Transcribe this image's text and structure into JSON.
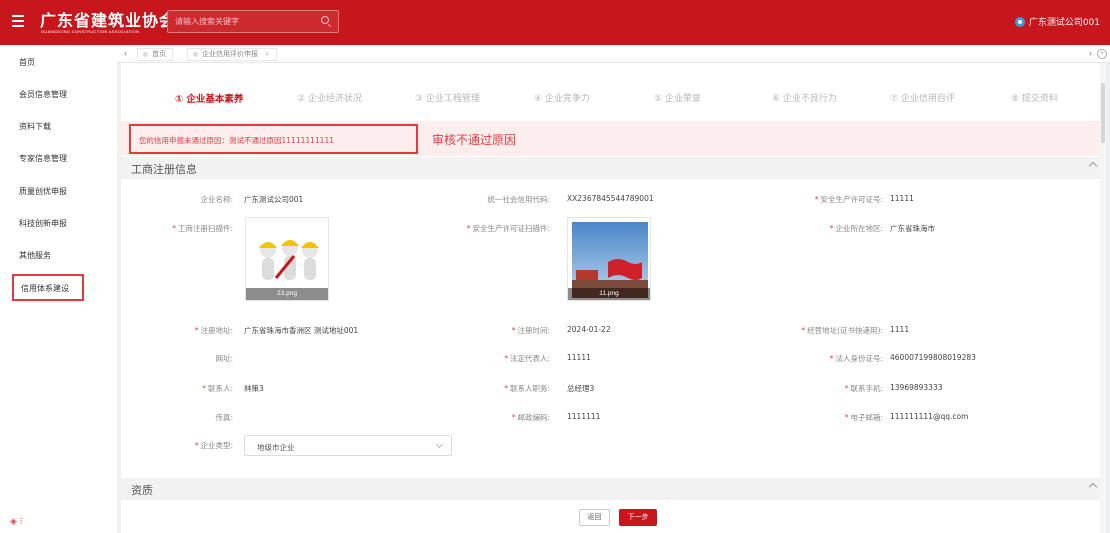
{
  "header": {
    "logo_cn": "广东省建筑业协会",
    "logo_en": "GUANGDONG CONSTRUCTION ASSOCIATION",
    "search_placeholder": "请输入搜索关键字",
    "user_name": "广东测试公司001",
    "brand_color": "#c8161d"
  },
  "sidebar": {
    "items": [
      {
        "label": "首页"
      },
      {
        "label": "会员信息管理"
      },
      {
        "label": "资料下载"
      },
      {
        "label": "专家信息管理"
      },
      {
        "label": "质量创优申报"
      },
      {
        "label": "科技创新申报"
      },
      {
        "label": "其他服务"
      },
      {
        "label": "信用体系建设"
      }
    ],
    "bottom_icon": "logo-icon"
  },
  "tabs": {
    "items": [
      {
        "label": "首页"
      },
      {
        "label": "企业信用评价申报",
        "close": "×"
      }
    ]
  },
  "steps": [
    {
      "label": "① 企业基本素养"
    },
    {
      "label": "② 企业经济状况"
    },
    {
      "label": "③ 企业工程管理"
    },
    {
      "label": "④ 企业竞争力"
    },
    {
      "label": "⑤ 企业荣誉"
    },
    {
      "label": "⑥ 企业不良行为"
    },
    {
      "label": "⑦ 企业信用自评"
    },
    {
      "label": "⑧ 提交资料"
    }
  ],
  "alert": {
    "message": "您的信用申报未通过原因：测试不通过原因11111111111",
    "annotation": "审核不通过原因"
  },
  "section1": {
    "title": "工商注册信息",
    "fields": {
      "company_name": {
        "label": "企业名称:",
        "value": "广东测试公司001"
      },
      "credit_code": {
        "label": "统一社会信用代码:",
        "value": "XX2367845544789001"
      },
      "safety_cert": {
        "label": "安全生产许可证号:",
        "value": "11111"
      },
      "reg_scan": {
        "label": "工商注册扫描件:",
        "file": "23.png"
      },
      "safety_scan": {
        "label": "安全生产许可证扫描件:",
        "file": "11.png"
      },
      "region": {
        "label": "企业所在地区:",
        "value": "广东省珠海市"
      },
      "reg_address": {
        "label": "注册地址:",
        "value": "广东省珠海市香洲区 测试地址001"
      },
      "reg_time": {
        "label": "注册时间:",
        "value": "2024-01-22"
      },
      "biz_address": {
        "label": "经营地址(证书快递用):",
        "value": "1111"
      },
      "website": {
        "label": "网址:",
        "value": ""
      },
      "legal_rep": {
        "label": "法定代表人:",
        "value": "11111"
      },
      "legal_id": {
        "label": "法人身份证号:",
        "value": "460007199808019283"
      },
      "contact": {
        "label": "联系人:",
        "value": "林策3"
      },
      "contact_title": {
        "label": "联系人职务:",
        "value": "总经理3"
      },
      "phone": {
        "label": "联系手机:",
        "value": "13969893333"
      },
      "fax": {
        "label": "传真:",
        "value": ""
      },
      "postcode": {
        "label": "邮政编码:",
        "value": "1111111"
      },
      "email": {
        "label": "电子邮箱:",
        "value": "111111111@qq.com"
      },
      "company_type": {
        "label": "企业类型:",
        "value": "地级市企业"
      }
    }
  },
  "section2": {
    "title": "资质"
  },
  "buttons": {
    "back": "返回",
    "next": "下一步"
  }
}
